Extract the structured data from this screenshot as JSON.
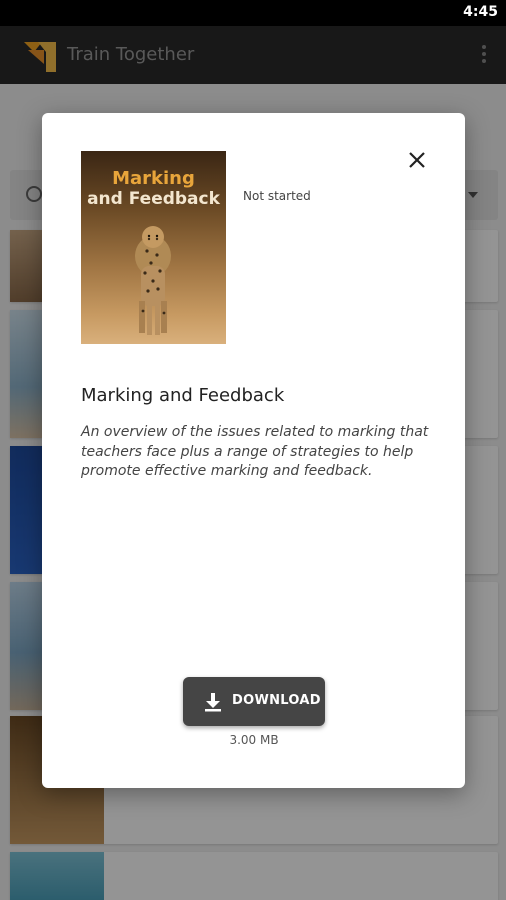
{
  "status_bar": {
    "time": "4:45"
  },
  "app_bar": {
    "title": "Train Together",
    "menu_icon": "overflow-menu-icon"
  },
  "dialog": {
    "cover": {
      "title_line1": "Marking",
      "title_line2": "and Feedback"
    },
    "status": "Not started",
    "title": "Marking and Feedback",
    "description": "An overview of the issues related to marking that teachers face plus a range of strategies to help promote effective marking and feedback.",
    "close_icon": "close-icon",
    "download": {
      "label": "DOWNLOAD",
      "icon": "download-icon"
    },
    "file_size": "3.00 MB"
  },
  "colors": {
    "app_bar": "#2a2a2a",
    "logo": "#f5a623",
    "button": "#454545",
    "cover_title": "#e8a53b"
  }
}
